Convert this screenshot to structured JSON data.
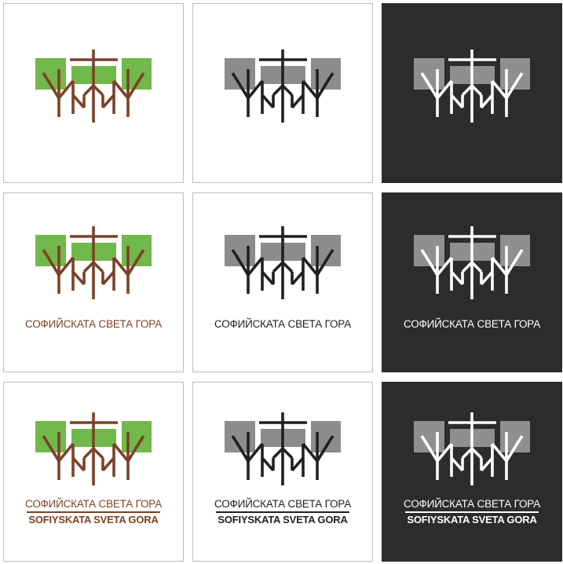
{
  "logo": {
    "name_bg": "СОФИЙСКАТА СВЕТА ГОРА",
    "name_latin": "SOFIYSKATA SVETA GORA"
  },
  "colors": {
    "color_canopy": "#71b94b",
    "color_trunk": "#7a4227",
    "grey_canopy": "#8c8c8c",
    "black_trunk": "#231f20",
    "dark_background": "#2d2b2b",
    "dark_canopy": "#8f8f8f",
    "white_trunk": "#ffffff"
  },
  "grid": {
    "rows": [
      {
        "caption": "none",
        "tiles": [
          "color",
          "grey",
          "dark"
        ]
      },
      {
        "caption": "bg",
        "tiles": [
          "color",
          "grey",
          "dark"
        ]
      },
      {
        "caption": "bg-latin",
        "tiles": [
          "color",
          "grey",
          "dark"
        ]
      }
    ]
  }
}
